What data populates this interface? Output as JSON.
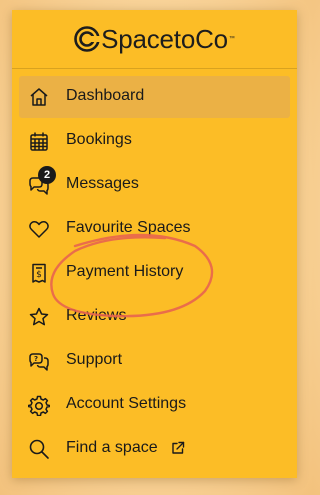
{
  "brand": {
    "name": "SpacetoCo",
    "trademark": "™",
    "accent_color": "#fcbd26",
    "highlight_color": "#e8644f"
  },
  "nav": {
    "items": [
      {
        "key": "dashboard",
        "label": "Dashboard",
        "icon": "home-icon",
        "active": true
      },
      {
        "key": "bookings",
        "label": "Bookings",
        "icon": "calendar-icon",
        "active": false
      },
      {
        "key": "messages",
        "label": "Messages",
        "icon": "chat-icon",
        "badge": "2",
        "active": false
      },
      {
        "key": "favourites",
        "label": "Favourite Spaces",
        "icon": "heart-icon",
        "active": false
      },
      {
        "key": "payments",
        "label": "Payment History",
        "icon": "receipt-icon",
        "active": false
      },
      {
        "key": "reviews",
        "label": "Reviews",
        "icon": "star-icon",
        "active": false
      },
      {
        "key": "support",
        "label": "Support",
        "icon": "question-chat-icon",
        "active": false
      },
      {
        "key": "settings",
        "label": "Account Settings",
        "icon": "gear-icon",
        "active": false
      },
      {
        "key": "find",
        "label": "Find a space",
        "icon": "search-icon",
        "external_icon": "external-link-icon",
        "active": false
      }
    ]
  }
}
